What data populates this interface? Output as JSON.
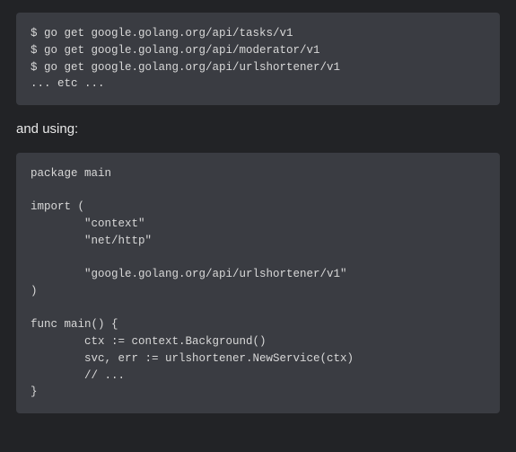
{
  "code_block_1": "$ go get google.golang.org/api/tasks/v1\n$ go get google.golang.org/api/moderator/v1\n$ go get google.golang.org/api/urlshortener/v1\n... etc ...",
  "body_text_1": "and using:",
  "code_block_2": "package main\n\nimport (\n        \"context\"\n        \"net/http\"\n\n        \"google.golang.org/api/urlshortener/v1\"\n)\n\nfunc main() {\n        ctx := context.Background()\n        svc, err := urlshortener.NewService(ctx)\n        // ...\n}"
}
